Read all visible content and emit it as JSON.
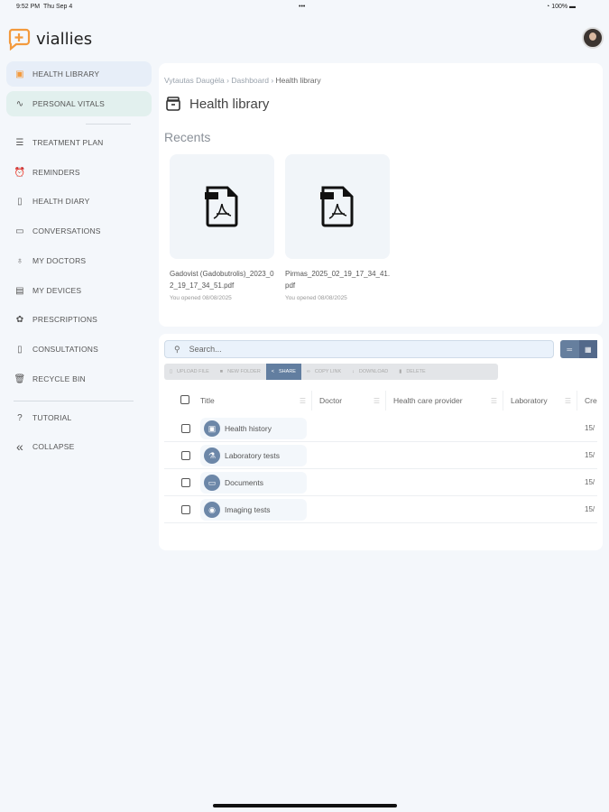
{
  "status": {
    "time": "9:52 PM",
    "date": "Thu Sep 4",
    "dots": "•••",
    "battery": "100%"
  },
  "app": {
    "name": "viallies"
  },
  "sidebar": {
    "items": [
      {
        "label": "HEALTH LIBRARY",
        "icon": "archive-icon"
      },
      {
        "label": "PERSONAL VITALS",
        "icon": "pulse-icon"
      },
      {
        "label": "TREATMENT PLAN",
        "icon": "clipboard-icon"
      },
      {
        "label": "REMINDERS",
        "icon": "alarm-icon"
      },
      {
        "label": "HEALTH DIARY",
        "icon": "book-icon"
      },
      {
        "label": "CONVERSATIONS",
        "icon": "chat-icon"
      },
      {
        "label": "MY DOCTORS",
        "icon": "stethoscope-icon"
      },
      {
        "label": "MY DEVICES",
        "icon": "device-icon"
      },
      {
        "label": "PRESCRIPTIONS",
        "icon": "pills-icon"
      },
      {
        "label": "CONSULTATIONS",
        "icon": "book-open-icon"
      },
      {
        "label": "RECYCLE BIN",
        "icon": "trash-icon"
      },
      {
        "label": "TUTORIAL",
        "icon": "help-icon"
      },
      {
        "label": "COLLAPSE",
        "icon": "double-chevron-left-icon"
      }
    ]
  },
  "breadcrumb": [
    "Vytautas Daugėla",
    "Dashboard",
    "Health library"
  ],
  "page_title": "Health library",
  "recents": {
    "heading": "Recents",
    "files": [
      {
        "name": "Gadovist (Gadobutrolis)_2023_02_19_17_34_51.pdf",
        "opened": "You opened 08/08/2025"
      },
      {
        "name": "Pirmas_2025_02_19_17_34_41.pdf",
        "opened": "You opened 08/08/2025"
      }
    ]
  },
  "search": {
    "placeholder": "Search..."
  },
  "toolbar": [
    "UPLOAD FILE",
    "NEW FOLDER",
    "SHARE",
    "COPY LINK",
    "DOWNLOAD",
    "DELETE"
  ],
  "columns": [
    "Title",
    "Doctor",
    "Health care provider",
    "Laboratory",
    "Cre"
  ],
  "rows": [
    {
      "title": "Health history",
      "date": "15/"
    },
    {
      "title": "Laboratory tests",
      "date": "15/"
    },
    {
      "title": "Documents",
      "date": "15/"
    },
    {
      "title": "Imaging tests",
      "date": "15/"
    }
  ],
  "colors": {
    "accent": "#f39a3d",
    "primary": "#627ea0",
    "background": "#f4f7fb"
  }
}
